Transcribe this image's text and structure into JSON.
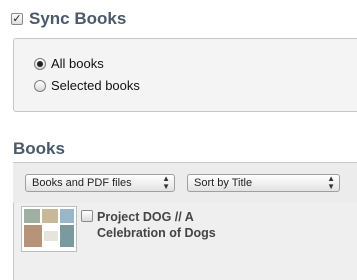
{
  "sync": {
    "checked": true,
    "title": "Sync Books",
    "options": [
      {
        "label": "All books",
        "selected": true
      },
      {
        "label": "Selected books",
        "selected": false
      }
    ]
  },
  "books": {
    "title": "Books",
    "filter_select": "Books and PDF files",
    "sort_select": "Sort by Title",
    "items": [
      {
        "title": "Project DOG // A Celebration of Dogs",
        "checked": false
      }
    ]
  }
}
